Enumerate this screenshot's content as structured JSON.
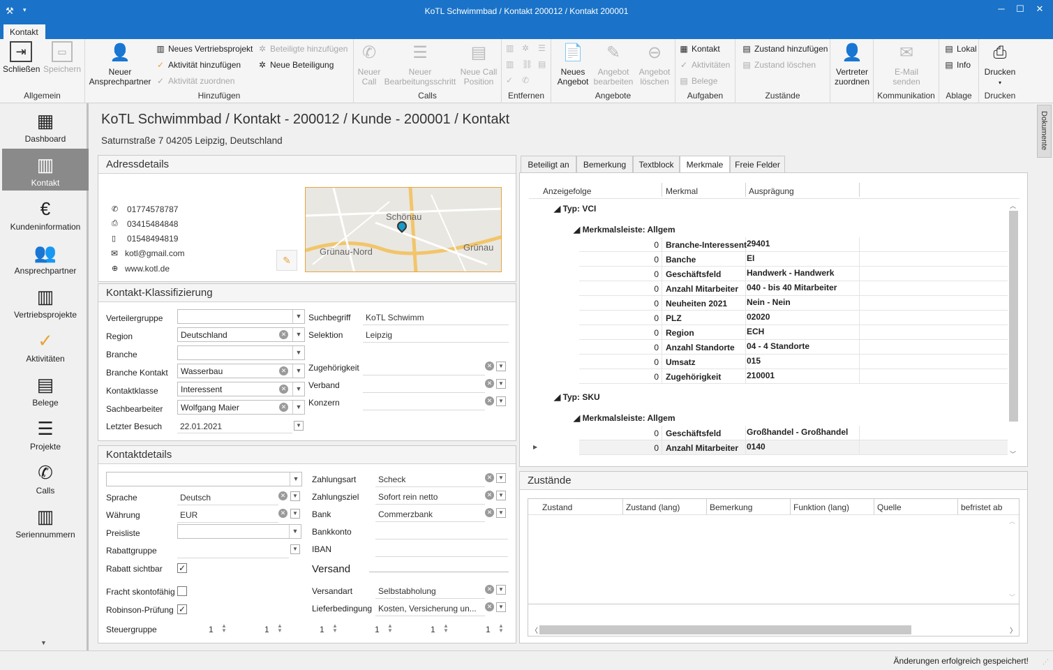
{
  "window": {
    "title": "KoTL Schwimmbad / Kontakt 200012 / Kontakt 200001"
  },
  "ribbon_tab": "Kontakt",
  "ribbon": {
    "allgemein": {
      "label": "Allgemein",
      "close": "Schließen",
      "save": "Speichern"
    },
    "hinzufuegen": {
      "label": "Hinzufügen",
      "new_contact_line1": "Neuer",
      "new_contact_line2": "Ansprechpartner",
      "new_sales_project": "Neues Vertriebsprojekt",
      "add_activity": "Aktivität hinzufügen",
      "assign_activity": "Aktivität zuordnen",
      "add_participants": "Beteiligte hinzufügen",
      "new_participation": "Neue Beteiligung"
    },
    "calls": {
      "label": "Calls",
      "new_call_1": "Neuer",
      "new_call_2": "Call",
      "new_step_1": "Neuer",
      "new_step_2": "Bearbeitungsschritt",
      "new_call_pos_1": "Neue Call",
      "new_call_pos_2": "Position"
    },
    "entfernen": {
      "label": "Entfernen"
    },
    "angebote": {
      "label": "Angebote",
      "new_offer_1": "Neues",
      "new_offer_2": "Angebot",
      "edit_offer_1": "Angebot",
      "edit_offer_2": "bearbeiten",
      "del_offer_1": "Angebot",
      "del_offer_2": "löschen"
    },
    "aufgaben": {
      "label": "Aufgaben",
      "contact": "Kontakt",
      "activities": "Aktivitäten",
      "receipts": "Belege"
    },
    "zustaende": {
      "label": "Zustände",
      "add_state": "Zustand hinzufügen",
      "del_state": "Zustand löschen"
    },
    "vertreter": {
      "line1": "Vertreter",
      "line2": "zuordnen"
    },
    "kommunikation": {
      "label": "Kommunikation",
      "email_1": "E-Mail",
      "email_2": "senden"
    },
    "ablage": {
      "label": "Ablage",
      "local": "Lokal",
      "info": "Info"
    },
    "drucken": {
      "label": "Drucken",
      "print": "Drucken"
    }
  },
  "sidebar": {
    "items": [
      {
        "label": "Dashboard",
        "icon": "dashboard-icon"
      },
      {
        "label": "Kontakt",
        "icon": "building-icon"
      },
      {
        "label": "Kundeninformation",
        "icon": "euro-chart-icon"
      },
      {
        "label": "Ansprechpartner",
        "icon": "people-icon"
      },
      {
        "label": "Vertriebsprojekte",
        "icon": "projects-icon"
      },
      {
        "label": "Aktivitäten",
        "icon": "check-circle-icon"
      },
      {
        "label": "Belege",
        "icon": "document-icon"
      },
      {
        "label": "Projekte",
        "icon": "list-icon"
      },
      {
        "label": "Calls",
        "icon": "phone-icon"
      },
      {
        "label": "Seriennummern",
        "icon": "barcode-icon"
      }
    ]
  },
  "header": {
    "title": "KoTL Schwimmbad / Kontakt - 200012 / Kunde - 200001 / Kontakt",
    "address": "Saturnstraße 7 04205 Leipzig, Deutschland"
  },
  "adressdetails": {
    "title": "Adressdetails",
    "phone": "01774578787",
    "fax": "03415484848",
    "mobile": "01548494819",
    "email": "kotl@gmail.com",
    "web": "www.kotl.de",
    "map_labels": {
      "a": "Schönau",
      "b": "Grünau-Nord",
      "c": "Grünau"
    }
  },
  "klassifizierung": {
    "title": "Kontakt-Klassifizierung",
    "labels": {
      "verteilergruppe": "Verteilergruppe",
      "region": "Region",
      "branche": "Branche",
      "branche_kontakt": "Branche Kontakt",
      "kontaktklasse": "Kontaktklasse",
      "sachbearbeiter": "Sachbearbeiter",
      "letzter_besuch": "Letzter Besuch",
      "suchbegriff": "Suchbegriff",
      "selektion": "Selektion",
      "zugehoerigkeit": "Zugehörigkeit",
      "verband": "Verband",
      "konzern": "Konzern"
    },
    "values": {
      "verteilergruppe": "",
      "region": "Deutschland",
      "branche": "",
      "branche_kontakt": "Wasserbau",
      "kontaktklasse": "Interessent",
      "sachbearbeiter": "Wolfgang Maier",
      "letzter_besuch": "22.01.2021",
      "suchbegriff": "KoTL Schwimm",
      "selektion": "Leipzig"
    }
  },
  "kontaktdetails": {
    "title": "Kontaktdetails",
    "labels": {
      "sprache": "Sprache",
      "waehrung": "Währung",
      "preisliste": "Preisliste",
      "rabattgruppe": "Rabattgruppe",
      "rabatt_sichtbar": "Rabatt sichtbar",
      "fracht": "Fracht skontofähig",
      "robinson": "Robinson-Prüfung",
      "steuergruppe": "Steuergruppe",
      "zahlungsart": "Zahlungsart",
      "zahlungsziel": "Zahlungsziel",
      "bank": "Bank",
      "bankkonto": "Bankkonto",
      "iban": "IBAN",
      "versand": "Versand",
      "versandart": "Versandart",
      "lieferbedingung": "Lieferbedingung"
    },
    "values": {
      "top_select": "",
      "sprache": "Deutsch",
      "waehrung": "EUR",
      "preisliste": "",
      "zahlungsart": "Scheck",
      "zahlungsziel": "Sofort rein netto",
      "bank": "Commerzbank",
      "versandart": "Selbstabholung",
      "lieferbedingung": "Kosten, Versicherung un...",
      "steuer": [
        "1",
        "1",
        "1",
        "1",
        "1",
        "1"
      ]
    },
    "checks": {
      "rabatt_sichtbar": true,
      "fracht": false,
      "robinson": true
    }
  },
  "tabs": [
    "Beteiligt an",
    "Bemerkung",
    "Textblock",
    "Merkmale",
    "Freie Felder"
  ],
  "merkmale": {
    "columns": [
      "Anzeigefolge",
      "Merkmal",
      "Ausprägung"
    ],
    "group1": "Typ: VCI",
    "subgroup1": "Merkmalsleiste: Allgem",
    "rows1": [
      {
        "order": "0",
        "name": "Branche-Interessent",
        "value": "29401"
      },
      {
        "order": "0",
        "name": "Banche",
        "value": "EI"
      },
      {
        "order": "0",
        "name": "Geschäftsfeld",
        "value": "Handwerk - Handwerk"
      },
      {
        "order": "0",
        "name": "Anzahl Mitarbeiter",
        "value": "040 - bis 40 Mitarbeiter"
      },
      {
        "order": "0",
        "name": "Neuheiten 2021",
        "value": "Nein - Nein"
      },
      {
        "order": "0",
        "name": "PLZ",
        "value": "02020"
      },
      {
        "order": "0",
        "name": "Region",
        "value": "ECH"
      },
      {
        "order": "0",
        "name": "Anzahl Standorte",
        "value": "04 - 4 Standorte"
      },
      {
        "order": "0",
        "name": "Umsatz",
        "value": "015"
      },
      {
        "order": "0",
        "name": "Zugehörigkeit",
        "value": "210001"
      }
    ],
    "group2": "Typ: SKU",
    "subgroup2": "Merkmalsleiste: Allgem",
    "rows2": [
      {
        "order": "0",
        "name": "Geschäftsfeld",
        "value": "Großhandel - Großhandel"
      },
      {
        "order": "0",
        "name": "Anzahl Mitarbeiter",
        "value": "0140"
      }
    ]
  },
  "zustaende": {
    "title": "Zustände",
    "columns": [
      "Zustand",
      "Zustand (lang)",
      "Bemerkung",
      "Funktion (lang)",
      "Quelle",
      "befristet ab"
    ]
  },
  "docs_tab": "Dokumente",
  "status": "Änderungen erfolgreich gespeichert!",
  "colors": {
    "titlebar": "#1a73c8",
    "accent_orange": "#e8a33c",
    "active_nav": "#8a8a8a"
  }
}
